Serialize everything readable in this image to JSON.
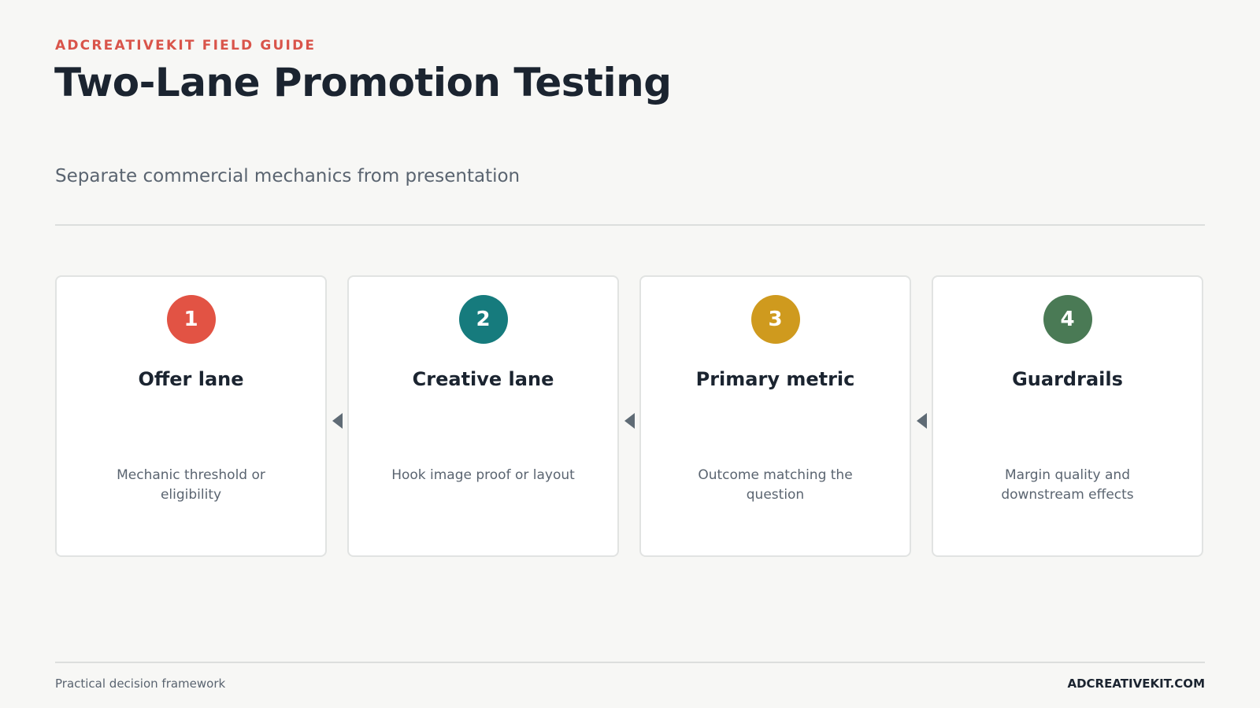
{
  "header": {
    "eyebrow": "ADCREATIVEKIT FIELD GUIDE",
    "title": "Two-Lane Promotion Testing",
    "subtitle": "Separate commercial mechanics from presentation"
  },
  "steps": [
    {
      "number": "1",
      "title": "Offer lane",
      "description": "Mechanic threshold or eligibility",
      "color": "#e25344"
    },
    {
      "number": "2",
      "title": "Creative lane",
      "description": "Hook image proof or layout",
      "color": "#167b7d"
    },
    {
      "number": "3",
      "title": "Primary metric",
      "description": "Outcome matching the question",
      "color": "#cf9a1e"
    },
    {
      "number": "4",
      "title": "Guardrails",
      "description": "Margin quality and downstream effects",
      "color": "#4a7a55"
    }
  ],
  "footer": {
    "left": "Practical decision framework",
    "right": "ADCREATIVEKIT.COM"
  }
}
